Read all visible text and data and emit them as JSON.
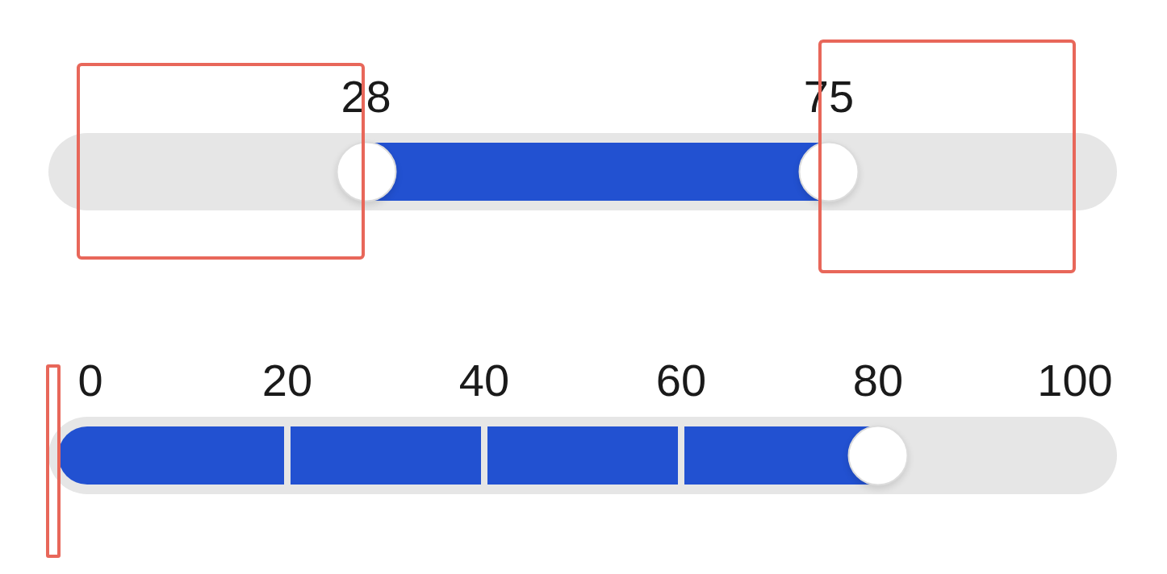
{
  "range_slider": {
    "thumbs": [
      {
        "value": "28",
        "level": 0.28
      },
      {
        "value": "75",
        "level": 0.75
      }
    ]
  },
  "step_slider": {
    "ticks": [
      "0",
      "20",
      "40",
      "60",
      "80",
      "100"
    ],
    "level": 0.8
  }
}
